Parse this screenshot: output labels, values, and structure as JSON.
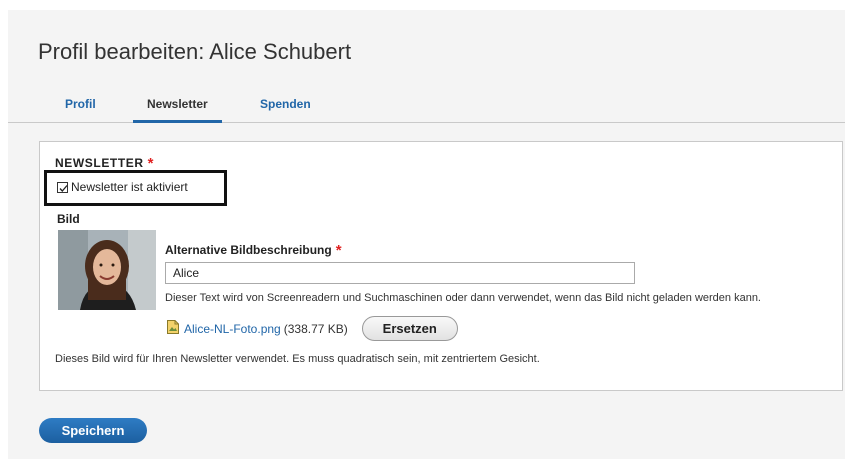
{
  "header": {
    "title": "Profil bearbeiten: Alice Schubert"
  },
  "tabs": [
    {
      "label": "Profil",
      "active": false
    },
    {
      "label": "Newsletter",
      "active": true
    },
    {
      "label": "Spenden",
      "active": false
    }
  ],
  "newsletter": {
    "section_title": "NEWSLETTER",
    "required_mark": "*",
    "checkbox_label": "Newsletter ist aktiviert",
    "checkbox_checked": true,
    "image_label": "Bild",
    "alt_label": "Alternative Bildbeschreibung",
    "alt_required_mark": "*",
    "alt_value": "Alice",
    "alt_description": "Dieser Text wird von Screenreadern und Suchmaschinen oder dann verwendet, wenn das Bild nicht geladen werden kann.",
    "file_name": "Alice-NL-Foto.png",
    "file_size": "(338.77 KB)",
    "replace_label": "Ersetzen",
    "help_text": "Dieses Bild wird für Ihren Newsletter verwendet. Es muss quadratisch sein, mit zentriertem Gesicht."
  },
  "actions": {
    "save_label": "Speichern"
  },
  "colors": {
    "accent": "#2166a8",
    "required": "#e02020",
    "page_bg": "#f4f4f4"
  }
}
